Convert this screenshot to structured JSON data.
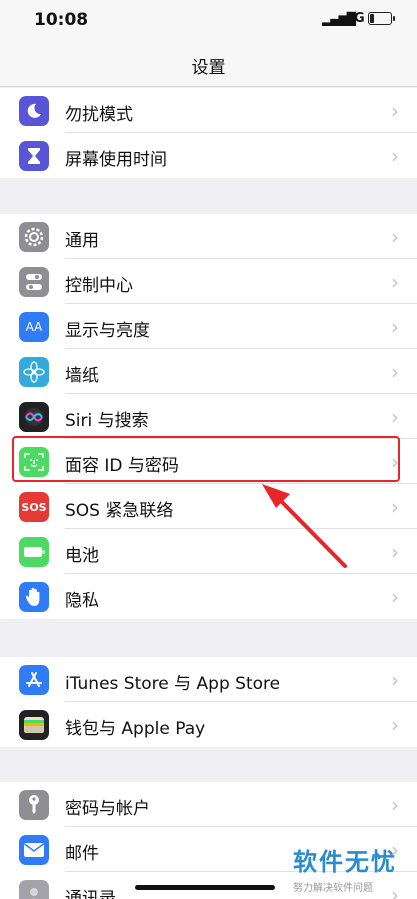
{
  "status_bar": {
    "time": "10:08",
    "network": "4G"
  },
  "nav": {
    "title": "设置"
  },
  "group1": [
    {
      "label": "勿扰模式",
      "icon": "moon-icon",
      "color": "#5856d6"
    },
    {
      "label": "屏幕使用时间",
      "icon": "hourglass-icon",
      "color": "#5856d6"
    }
  ],
  "group2": [
    {
      "label": "通用",
      "icon": "gear-icon",
      "color": "#8e8e93"
    },
    {
      "label": "控制中心",
      "icon": "toggles-icon",
      "color": "#8e8e93"
    },
    {
      "label": "显示与亮度",
      "icon": "text-size-icon",
      "color": "#2f7cf6"
    },
    {
      "label": "墙纸",
      "icon": "flower-icon",
      "color": "#34aadc"
    },
    {
      "label": "Siri 与搜索",
      "icon": "siri-icon",
      "color": "#222222"
    },
    {
      "label": "面容 ID 与密码",
      "icon": "face-id-icon",
      "color": "#4cd964"
    },
    {
      "label": "SOS 紧急联络",
      "icon": "sos-icon",
      "color": "#e53935"
    },
    {
      "label": "电池",
      "icon": "battery-icon",
      "color": "#4cd964"
    },
    {
      "label": "隐私",
      "icon": "hand-icon",
      "color": "#2f7cf6"
    }
  ],
  "group3": [
    {
      "label": "iTunes Store 与 App Store",
      "icon": "app-store-icon",
      "color": "#2f7cf6"
    },
    {
      "label": "钱包与 Apple Pay",
      "icon": "wallet-icon",
      "color": "#222222"
    }
  ],
  "group4": [
    {
      "label": "密码与帐户",
      "icon": "key-icon",
      "color": "#8e8e93"
    },
    {
      "label": "邮件",
      "icon": "mail-icon",
      "color": "#2f7cf6"
    },
    {
      "label": "通讯录",
      "icon": "contacts-icon",
      "color": "#a2a2a8"
    }
  ],
  "icons_text": {
    "sos": "SOS",
    "text_size": "AA"
  },
  "watermark": {
    "title": "软件无忧",
    "subtitle": "努力解决软件问题"
  },
  "annotation": {
    "highlight_color": "#e8262a"
  }
}
